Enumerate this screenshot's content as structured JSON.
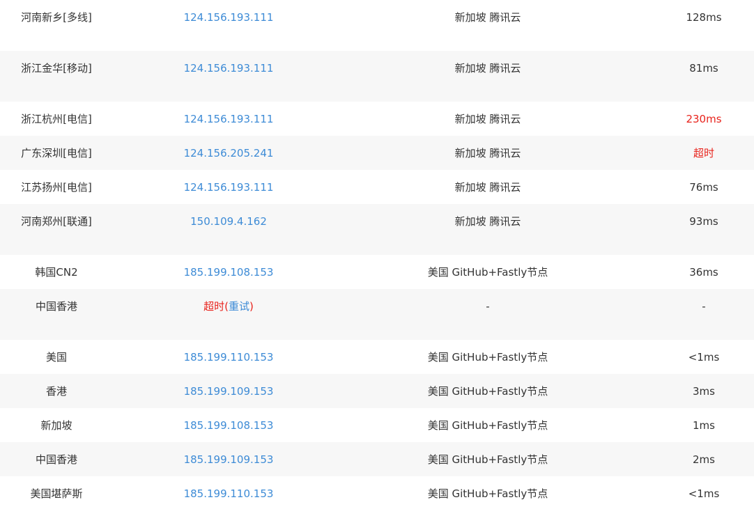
{
  "colors": {
    "ip_link": "#3d8bd6",
    "warning": "#e8231c",
    "text": "#333333",
    "row_shade": "#f7f7f7"
  },
  "rows": [
    {
      "node": "河南新乡[多线]",
      "ip": "124.156.193.111",
      "location": "新加坡 腾讯云",
      "latency": "128ms"
    },
    {
      "node": "浙江金华[移动]",
      "ip": "124.156.193.111",
      "location": "新加坡 腾讯云",
      "latency": "81ms"
    },
    {
      "node": "浙江杭州[电信]",
      "ip": "124.156.193.111",
      "location": "新加坡 腾讯云",
      "latency": "230ms"
    },
    {
      "node": "广东深圳[电信]",
      "ip": "124.156.205.241",
      "location": "新加坡 腾讯云",
      "latency": "超时"
    },
    {
      "node": "江苏扬州[电信]",
      "ip": "124.156.193.111",
      "location": "新加坡 腾讯云",
      "latency": "76ms"
    },
    {
      "node": "河南郑州[联通]",
      "ip": "150.109.4.162",
      "location": "新加坡 腾讯云",
      "latency": "93ms"
    },
    {
      "node": "韩国CN2",
      "ip": "185.199.108.153",
      "location": "美国 GitHub+Fastly节点",
      "latency": "36ms"
    },
    {
      "node": "中国香港",
      "ip_timeout": "超时",
      "ip_retry": "重试",
      "location": "-",
      "latency": "-"
    },
    {
      "node": "美国",
      "ip": "185.199.110.153",
      "location": "美国 GitHub+Fastly节点",
      "latency": "<1ms"
    },
    {
      "node": "香港",
      "ip": "185.199.109.153",
      "location": "美国 GitHub+Fastly节点",
      "latency": "3ms"
    },
    {
      "node": "新加坡",
      "ip": "185.199.108.153",
      "location": "美国 GitHub+Fastly节点",
      "latency": "1ms"
    },
    {
      "node": "中国香港",
      "ip": "185.199.109.153",
      "location": "美国 GitHub+Fastly节点",
      "latency": "2ms"
    },
    {
      "node": "美国堪萨斯",
      "ip": "185.199.110.153",
      "location": "美国 GitHub+Fastly节点",
      "latency": "<1ms"
    }
  ]
}
